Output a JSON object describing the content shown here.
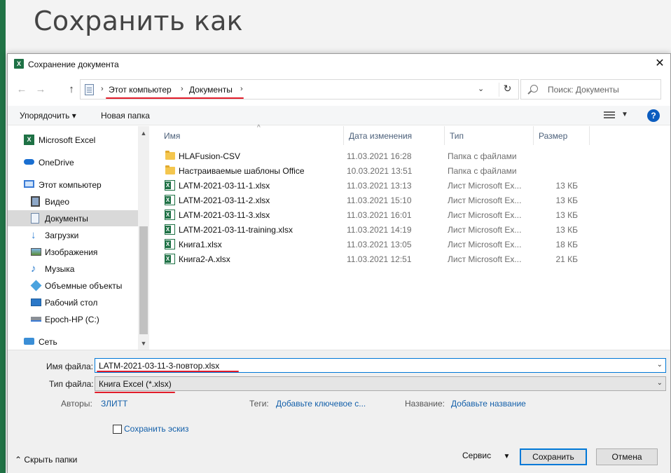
{
  "backstage": {
    "title": "Сохранить как"
  },
  "dialog": {
    "title": "Сохранение документа",
    "app_icon": "excel-icon",
    "close_glyph": "✕"
  },
  "nav": {
    "back_glyph": "←",
    "forward_glyph": "→",
    "up_glyph": "↑",
    "breadcrumbs": [
      "Этот компьютер",
      "Документы"
    ],
    "refresh_glyph": "↻",
    "search_placeholder": "Поиск: Документы"
  },
  "toolbar": {
    "organize_label": "Упорядочить ▾",
    "new_folder_label": "Новая папка",
    "help_glyph": "?"
  },
  "sidebar": {
    "items": [
      {
        "label": "Microsoft Excel",
        "icon": "excel-icon"
      },
      {
        "label": "OneDrive",
        "icon": "cloud-icon"
      },
      {
        "label": "Этот компьютер",
        "icon": "computer-icon"
      },
      {
        "label": "Видео",
        "icon": "video-icon"
      },
      {
        "label": "Документы",
        "icon": "documents-icon",
        "selected": true
      },
      {
        "label": "Загрузки",
        "icon": "download-icon"
      },
      {
        "label": "Изображения",
        "icon": "images-icon"
      },
      {
        "label": "Музыка",
        "icon": "music-icon"
      },
      {
        "label": "Объемные объекты",
        "icon": "3d-objects-icon"
      },
      {
        "label": "Рабочий стол",
        "icon": "desktop-icon"
      },
      {
        "label": "Epoch-HP (C:)",
        "icon": "drive-icon"
      },
      {
        "label": "Сеть",
        "icon": "network-icon"
      }
    ]
  },
  "columns": {
    "name": "Имя",
    "date": "Дата изменения",
    "type": "Тип",
    "size": "Размер"
  },
  "files": [
    {
      "name": "HLAFusion-CSV",
      "date": "11.03.2021 16:28",
      "type": "Папка с файлами",
      "size": "",
      "kind": "folder"
    },
    {
      "name": "Настраиваемые шаблоны Office",
      "date": "10.03.2021 13:51",
      "type": "Папка с файлами",
      "size": "",
      "kind": "folder"
    },
    {
      "name": "LATM-2021-03-11-1.xlsx",
      "date": "11.03.2021 13:13",
      "type": "Лист Microsoft Ex...",
      "size": "13 КБ",
      "kind": "xlsx"
    },
    {
      "name": "LATM-2021-03-11-2.xlsx",
      "date": "11.03.2021 15:10",
      "type": "Лист Microsoft Ex...",
      "size": "13 КБ",
      "kind": "xlsx"
    },
    {
      "name": "LATM-2021-03-11-3.xlsx",
      "date": "11.03.2021 16:01",
      "type": "Лист Microsoft Ex...",
      "size": "13 КБ",
      "kind": "xlsx"
    },
    {
      "name": "LATM-2021-03-11-training.xlsx",
      "date": "11.03.2021 14:19",
      "type": "Лист Microsoft Ex...",
      "size": "13 КБ",
      "kind": "xlsx"
    },
    {
      "name": "Книга1.xlsx",
      "date": "11.03.2021 13:05",
      "type": "Лист Microsoft Ex...",
      "size": "18 КБ",
      "kind": "xlsx"
    },
    {
      "name": "Книга2-A.xlsx",
      "date": "11.03.2021 12:51",
      "type": "Лист Microsoft Ex...",
      "size": "21 КБ",
      "kind": "xlsx"
    }
  ],
  "form": {
    "filename_label": "Имя файла:",
    "filename_value": "LATM-2021-03-11-3-повтор.xlsx",
    "filetype_label": "Тип файла:",
    "filetype_value": "Книга Excel (*.xlsx)",
    "authors_label": "Авторы:",
    "authors_value": "ЗЛИТТ",
    "tags_label": "Теги:",
    "tags_value": "Добавьте ключевое с...",
    "title_label": "Название:",
    "title_value": "Добавьте название",
    "thumbnail_label": "Сохранить эскиз"
  },
  "footer": {
    "hide_folders_label": "Скрыть папки",
    "tools_label": "Сервис",
    "save_label": "Сохранить",
    "cancel_label": "Отмена"
  },
  "colors": {
    "excel_green": "#217346",
    "accent": "#0078d7",
    "highlight": "#e21c2a",
    "link": "#1460aa"
  }
}
